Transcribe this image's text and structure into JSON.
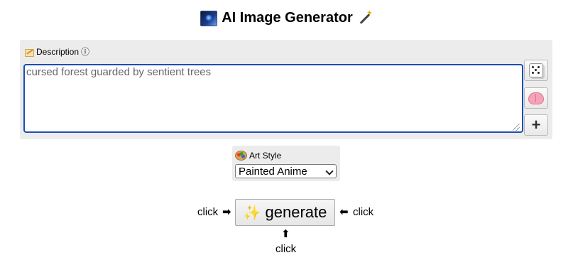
{
  "header": {
    "title": "AI Image Generator",
    "left_icon": "night-sky-icon",
    "right_icon": "magic-wand-icon"
  },
  "description": {
    "label": "Description",
    "info_glyph": "ⓘ",
    "value": "cursed forest guarded by sentient trees",
    "placeholder": ""
  },
  "side_buttons": [
    {
      "name": "random",
      "icon": "dice-icon"
    },
    {
      "name": "enhance",
      "icon": "brain-icon"
    },
    {
      "name": "add",
      "icon": "plus-icon",
      "glyph": "+"
    }
  ],
  "art_style": {
    "label": "Art Style",
    "selected": "Painted Anime"
  },
  "generate": {
    "label": "generate",
    "icon_glyph": "✨"
  },
  "hints": {
    "left": "click",
    "left_arrow": "➡",
    "right": "click",
    "right_arrow": "⬅",
    "bottom": "click",
    "bottom_arrow": "⬆"
  },
  "colors": {
    "accent": "#1a4fb3",
    "panel_bg": "#ececec"
  }
}
